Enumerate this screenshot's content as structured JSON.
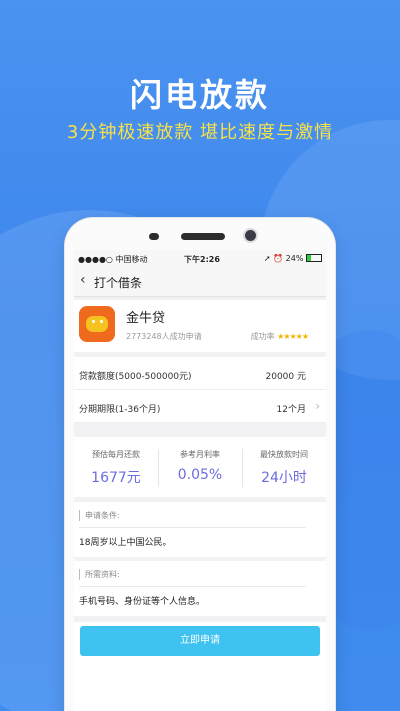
{
  "promo": {
    "headline": "闪电放款",
    "subline": "3分钟极速放款  堪比速度与激情"
  },
  "statusbar": {
    "carrier": "●●●●○ 中国移动",
    "time": "下午2:26",
    "right": "➚ ⏰ 24%"
  },
  "nav": {
    "back_icon": "‹",
    "title": "打个借条"
  },
  "product": {
    "name": "金牛贷",
    "applicants": "2773248人成功申请",
    "success_label": "成功率",
    "stars": "★★★★★",
    "rating": 4.5
  },
  "loan": {
    "amount_label": "贷款额度(5000-500000元)",
    "amount_value": "20000 元",
    "term_label": "分期期限(1-36个月)",
    "term_value": "12个月",
    "term_chevron": "›"
  },
  "stats": [
    {
      "label": "预估每月还款",
      "value": "1677元"
    },
    {
      "label": "参考月利率",
      "value": "0.05%"
    },
    {
      "label": "最快放款时间",
      "value": "24小时"
    }
  ],
  "conditions": {
    "title": "申请条件:",
    "body": "18周岁以上中国公民。"
  },
  "materials": {
    "title": "所需资料:",
    "body": "手机号码、身份证等个人信息。"
  },
  "apply_button": "立即申请",
  "colors": {
    "background": "#4b93f0",
    "headline_sub": "#f6e14a",
    "stat_value": "#6c6ce0",
    "button": "#3ec3f0",
    "logo": "#f06a1e"
  }
}
